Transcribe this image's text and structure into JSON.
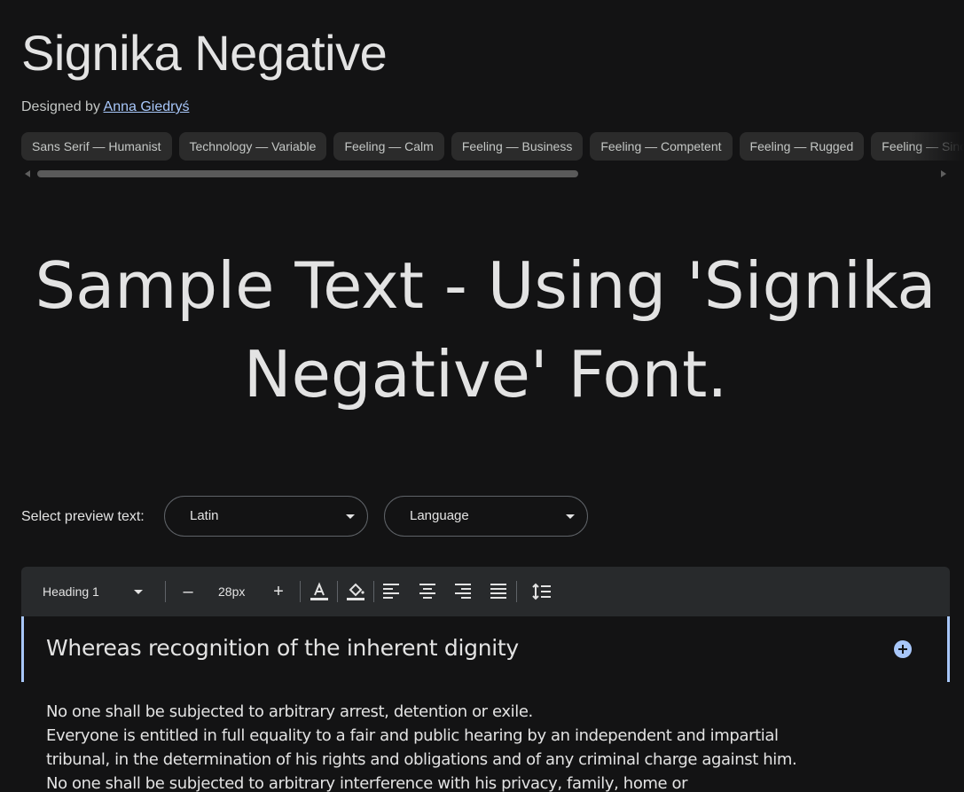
{
  "font": {
    "name": "Signika Negative",
    "designer_prefix": "Designed by",
    "designer_name": "Anna Giedryś"
  },
  "tags": [
    "Sans Serif — Humanist",
    "Technology — Variable",
    "Feeling — Calm",
    "Feeling — Business",
    "Feeling — Competent",
    "Feeling — Rugged",
    "Feeling — Sincere"
  ],
  "sample_text": "Sample Text - Using 'Signika Negative' Font.",
  "preview": {
    "label": "Select preview text:",
    "script_value": "Latin",
    "language_value": "Language"
  },
  "toolbar": {
    "style_value": "Heading 1",
    "decrease_label": "–",
    "size_value": "28px",
    "increase_label": "+"
  },
  "editor": {
    "heading": "Whereas recognition of the inherent dignity",
    "body_lines": [
      "No one shall be subjected to arbitrary arrest, detention or exile.",
      "Everyone is entitled in full equality to a fair and public hearing by an independent and impartial",
      "tribunal, in the determination of his rights and obligations and of any criminal charge against him.",
      "No one shall be subjected to arbitrary interference with his privacy, family, home or"
    ]
  },
  "colors": {
    "background": "#131314",
    "accent": "#a8c7fa",
    "chip": "#2b2b2b",
    "toolbar": "#282a2c"
  }
}
